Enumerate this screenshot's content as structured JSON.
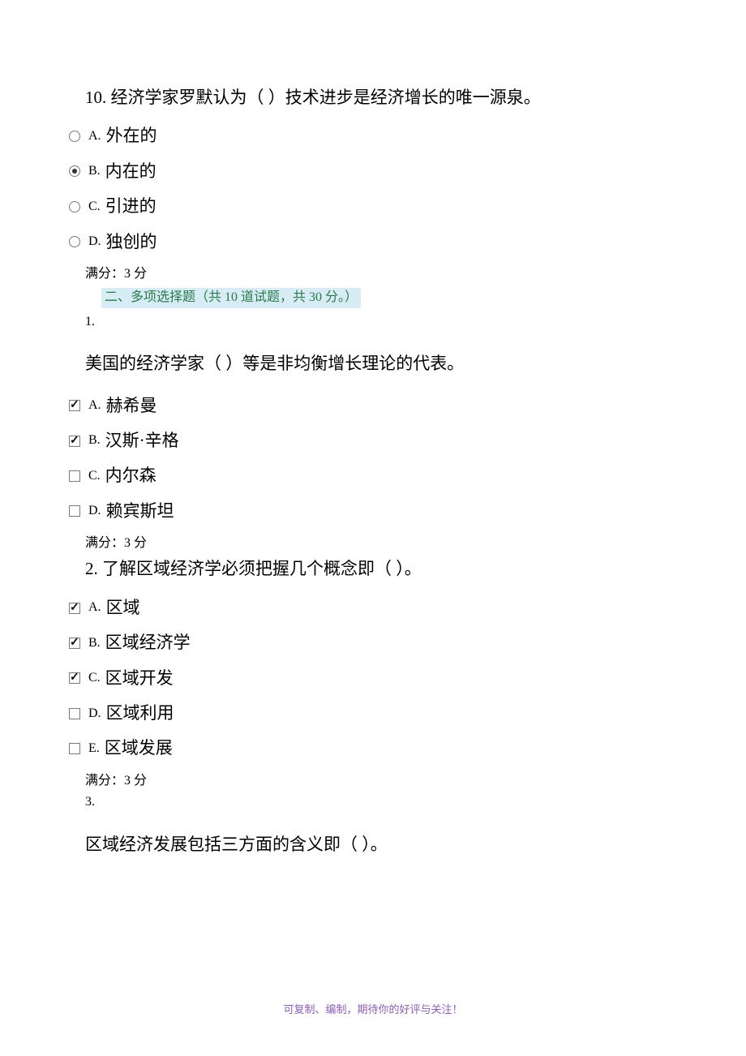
{
  "q10": {
    "text": "10. 经济学家罗默认为（ ）技术进步是经济增长的唯一源泉。",
    "options": [
      {
        "letter": "A.",
        "text": "外在的",
        "selected": false
      },
      {
        "letter": "B.",
        "text": "内在的",
        "selected": true
      },
      {
        "letter": "C.",
        "text": "引进的",
        "selected": false
      },
      {
        "letter": "D.",
        "text": "独创的",
        "selected": false
      }
    ],
    "score": "满分：3 分"
  },
  "section2": {
    "header": "二、多项选择题（共 10 道试题，共 30 分。）"
  },
  "mq1": {
    "num": "1.",
    "text": "美国的经济学家（ ）等是非均衡增长理论的代表。",
    "options": [
      {
        "letter": "A.",
        "text": "赫希曼",
        "selected": true
      },
      {
        "letter": "B.",
        "text": "汉斯·辛格",
        "selected": true
      },
      {
        "letter": "C.",
        "text": "内尔森",
        "selected": false
      },
      {
        "letter": "D.",
        "text": "赖宾斯坦",
        "selected": false
      }
    ],
    "score": "满分：3 分"
  },
  "mq2": {
    "text": "2. 了解区域经济学必须把握几个概念即（ ）。",
    "options": [
      {
        "letter": "A.",
        "text": "区域",
        "selected": true
      },
      {
        "letter": "B.",
        "text": "区域经济学",
        "selected": true
      },
      {
        "letter": "C.",
        "text": "区域开发",
        "selected": true
      },
      {
        "letter": "D.",
        "text": "区域利用",
        "selected": false
      },
      {
        "letter": "E.",
        "text": "区域发展",
        "selected": false
      }
    ],
    "score": "满分：3 分"
  },
  "mq3": {
    "num": "3.",
    "text": "区域经济发展包括三方面的含义即（ ）。"
  },
  "footer": "可复制、编制，期待你的好评与关注！"
}
